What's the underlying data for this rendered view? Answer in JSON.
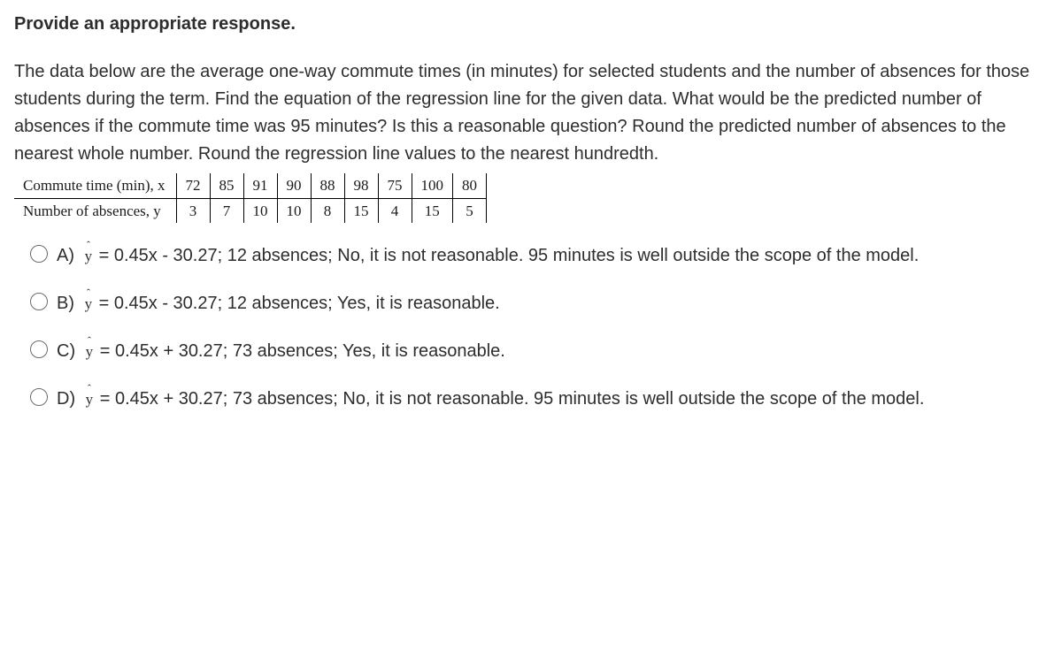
{
  "heading": "Provide an appropriate response.",
  "question": "The data below are the average one-way commute times (in minutes) for selected students and the number of absences for those students during the term. Find the equation of the regression line for the given data. What would be the predicted number of absences if the commute time was 95 minutes? Is this a reasonable question? Round the predicted number of absences to the nearest whole number. Round the regression line values to the nearest hundredth.",
  "table": {
    "rows": [
      {
        "label": "Commute time (min), x",
        "cells": [
          "72",
          "85",
          "91",
          "90",
          "88",
          "98",
          "75",
          "100",
          "80"
        ]
      },
      {
        "label": "Number of absences, y",
        "cells": [
          "3",
          "7",
          "10",
          "10",
          "8",
          "15",
          "4",
          "15",
          "5"
        ]
      }
    ]
  },
  "options": {
    "A": {
      "letter": "A)",
      "text": " = 0.45x - 30.27; 12 absences; No, it is not reasonable. 95 minutes is well outside the scope of the model."
    },
    "B": {
      "letter": "B)",
      "text": " = 0.45x - 30.27; 12 absences; Yes, it is reasonable."
    },
    "C": {
      "letter": "C)",
      "text": " = 0.45x + 30.27; 73 absences; Yes, it is reasonable."
    },
    "D": {
      "letter": "D)",
      "text": " = 0.45x + 30.27; 73 absences; No, it is not reasonable. 95 minutes is well outside the scope of the model."
    }
  },
  "chart_data": {
    "type": "table",
    "title": "Commute time vs. Number of absences",
    "xlabel": "Commute time (min), x",
    "ylabel": "Number of absences, y",
    "x": [
      72,
      85,
      91,
      90,
      88,
      98,
      75,
      100,
      80
    ],
    "y": [
      3,
      7,
      10,
      10,
      8,
      15,
      4,
      15,
      5
    ]
  }
}
